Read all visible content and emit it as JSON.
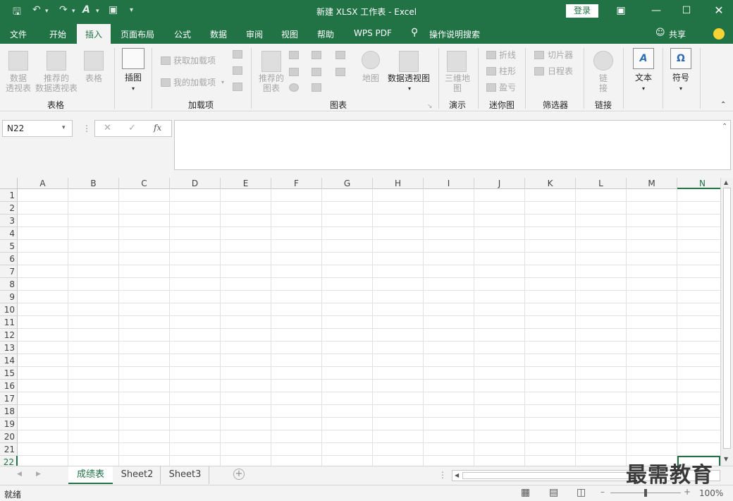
{
  "window": {
    "title": "新建 XLSX 工作表 - Excel",
    "login_label": "登录",
    "quick_access": [
      "save-icon",
      "undo-icon",
      "redo-icon",
      "format-painter-icon",
      "print-preview-icon",
      "customize-icon"
    ],
    "controls": [
      "ribbon-display-icon",
      "minimize-icon",
      "maximize-icon",
      "close-icon"
    ]
  },
  "menu": {
    "tabs": [
      "文件",
      "开始",
      "插入",
      "页面布局",
      "公式",
      "数据",
      "审阅",
      "视图",
      "帮助",
      "WPS PDF"
    ],
    "active_tab": "插入",
    "tell_me": "操作说明搜索",
    "share": "共享"
  },
  "ribbon": {
    "tables": {
      "pivot": "数据\n透视表",
      "rec_pivot": "推荐的\n数据透视表",
      "table": "表格",
      "group": "表格"
    },
    "illustrations": {
      "label": "插图"
    },
    "addins": {
      "get": "获取加载项",
      "mine": "我的加载项",
      "group": "加载项"
    },
    "charts": {
      "recommended": "推荐的\n图表",
      "map": "地图",
      "pivot_chart": "数据透视图",
      "group": "图表"
    },
    "tours": {
      "map3d": "三维地\n图",
      "group": "演示"
    },
    "sparklines": {
      "line": "折线",
      "column": "柱形",
      "winloss": "盈亏",
      "group": "迷你图"
    },
    "filters": {
      "slicer": "切片器",
      "timeline": "日程表",
      "group": "筛选器"
    },
    "links": {
      "link": "链\n接",
      "group": "链接"
    },
    "text": {
      "label": "文本"
    },
    "symbols": {
      "label": "符号"
    }
  },
  "formula_bar": {
    "name_box": "N22",
    "fx": "fx",
    "formula": ""
  },
  "grid": {
    "columns": [
      "A",
      "B",
      "C",
      "D",
      "E",
      "F",
      "G",
      "H",
      "I",
      "J",
      "K",
      "L",
      "M",
      "N"
    ],
    "rows": [
      "1",
      "2",
      "3",
      "4",
      "5",
      "6",
      "7",
      "8",
      "9",
      "10",
      "11",
      "12",
      "13",
      "14",
      "15",
      "16",
      "17",
      "18",
      "19",
      "20",
      "21",
      "22"
    ],
    "selected_cell": "N22"
  },
  "sheets": {
    "tabs": [
      "成绩表",
      "Sheet2",
      "Sheet3"
    ],
    "active": "成绩表"
  },
  "status": {
    "ready": "就绪",
    "zoom": "100%"
  },
  "watermark": "最需教育",
  "colors": {
    "brand": "#217346",
    "ribbon_bg": "#f3f3f3"
  }
}
